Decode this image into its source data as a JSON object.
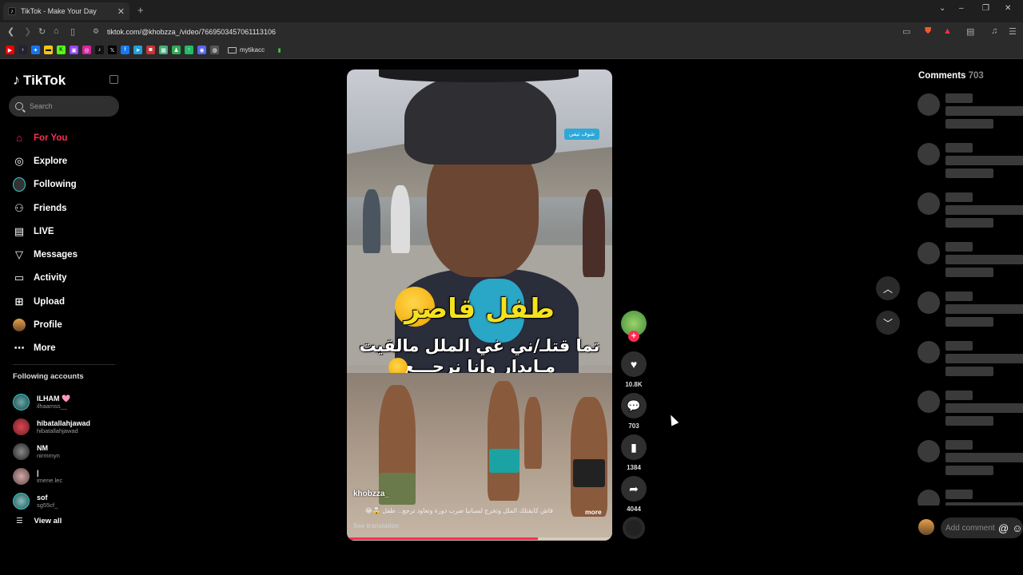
{
  "browser": {
    "tab_title": "TikTok - Make Your Day",
    "url": "tiktok.com/@khobzza_/video/7669503457061113106",
    "bookmark_folder": "mytikacc"
  },
  "sidebar": {
    "logo": "TikTok",
    "search_placeholder": "Search",
    "menu": [
      {
        "label": "For You",
        "icon": "home-icon"
      },
      {
        "label": "Explore",
        "icon": "compass-icon"
      },
      {
        "label": "Following",
        "icon": "following-avatar-icon"
      },
      {
        "label": "Friends",
        "icon": "friends-icon"
      },
      {
        "label": "LIVE",
        "icon": "live-icon"
      },
      {
        "label": "Messages",
        "icon": "messages-icon"
      },
      {
        "label": "Activity",
        "icon": "activity-icon"
      },
      {
        "label": "Upload",
        "icon": "upload-icon"
      },
      {
        "label": "Profile",
        "icon": "profile-avatar"
      },
      {
        "label": "More",
        "icon": "more-icon"
      }
    ],
    "following_title": "Following accounts",
    "accounts": [
      {
        "name": "ILHAM 🩷",
        "username": "ilhaamss__"
      },
      {
        "name": "hibatallahjawad",
        "username": "hibatallahjawad"
      },
      {
        "name": "NM",
        "username": "nirmmyn"
      },
      {
        "name": "|",
        "username": "imene.lec"
      },
      {
        "name": "sof",
        "username": "sg55cf_"
      }
    ],
    "view_all": "View all"
  },
  "video": {
    "overlay_line1": "طفل قاصر",
    "overlay_line2": "تما قتلـ/ني غي الملل مالقيت",
    "overlay_line3": "مـايدار وانا نرجـــع",
    "watermark": "شوف تيفي",
    "author": "khobzza_",
    "description": "قاش كايقتلك الملل وتخرج لسبانيا ضرب دورة وتعاود ترجع... طفل 🤯😂",
    "more": "more",
    "see_translation": "See translation",
    "progress": 0.72
  },
  "actions": {
    "likes": "10.8K",
    "comments": "703",
    "saves": "1384",
    "shares": "4044"
  },
  "comments_panel": {
    "title": "Comments",
    "count": "703",
    "input_placeholder": "Add comment..."
  }
}
